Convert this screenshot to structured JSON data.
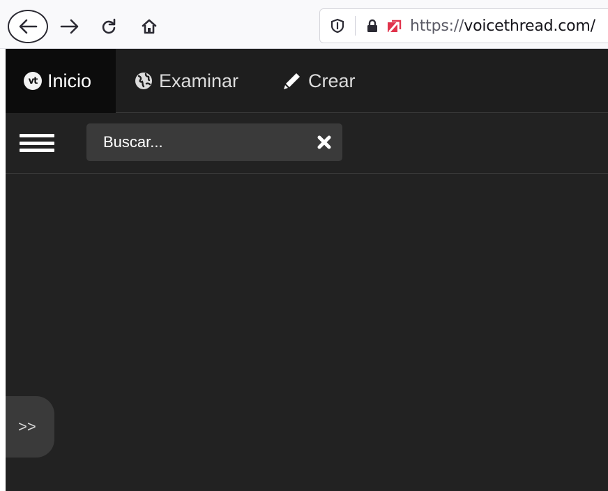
{
  "browser": {
    "url_prefix": "https://",
    "url_domain": "voicethread.com/",
    "icons": {
      "back": "back-arrow-icon",
      "forward": "forward-arrow-icon",
      "reload": "reload-icon",
      "home": "home-icon",
      "shield": "tracking-shield-icon",
      "lock": "lock-icon",
      "tracker": "tracker-blocked-icon"
    }
  },
  "app": {
    "nav": {
      "tabs": [
        {
          "label": "Inicio",
          "icon": "voicethread-logo-icon",
          "active": true
        },
        {
          "label": "Examinar",
          "icon": "globe-icon",
          "active": false
        },
        {
          "label": "Crear",
          "icon": "pencil-icon",
          "active": false
        }
      ],
      "logo_text": "vt"
    },
    "search": {
      "placeholder": "Buscar...",
      "value": ""
    },
    "expand_label": ">>"
  },
  "colors": {
    "app_background": "#222222",
    "nav_background": "#1e1e1e",
    "active_tab": "#0c0c0c",
    "search_background": "#3a3a3a",
    "tracker_red": "#e0334b"
  }
}
